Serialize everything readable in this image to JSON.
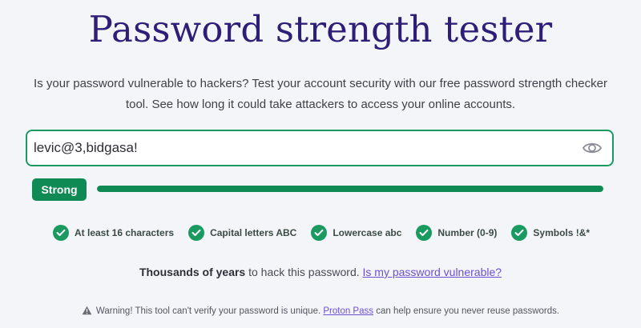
{
  "page": {
    "title": "Password strength tester",
    "subtitle": "Is your password vulnerable to hackers? Test your account security with our free password strength checker tool. See how long it could take attackers to access your online accounts."
  },
  "password_field": {
    "value": "levic@3,bidgasa!",
    "show_icon": "eye-icon"
  },
  "strength": {
    "label": "Strong",
    "level_percent": 100,
    "color": "#0f8a55"
  },
  "criteria": [
    {
      "label": "At least 16 characters",
      "met": true
    },
    {
      "label": "Capital letters ABC",
      "met": true
    },
    {
      "label": "Lowercase abc",
      "met": true
    },
    {
      "label": "Number (0-9)",
      "met": true
    },
    {
      "label": "Symbols !&*",
      "met": true
    }
  ],
  "result": {
    "time": "Thousands of years",
    "suffix": " to hack this password. ",
    "link": "Is my password vulnerable?"
  },
  "warning": {
    "icon": "warning-icon",
    "text_before": "Warning! This tool can't verify your password is unique. ",
    "link": "Proton Pass",
    "text_after": " can help ensure you never reuse passwords."
  },
  "colors": {
    "title": "#2f1e78",
    "accent_green": "#1a9a61",
    "link": "#6d4fd6"
  }
}
